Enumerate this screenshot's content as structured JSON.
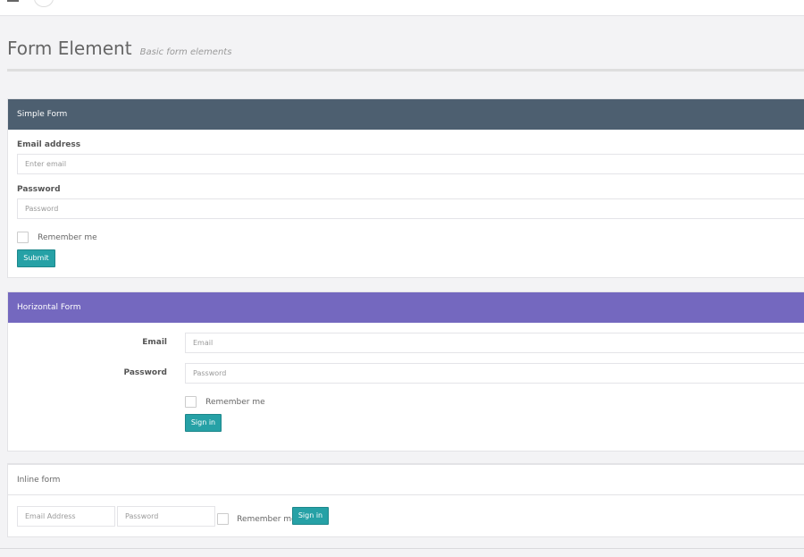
{
  "header": {
    "title": "Form Element",
    "subtitle": "Basic form elements"
  },
  "simple_form": {
    "heading": "Simple Form",
    "email_label": "Email address",
    "email_placeholder": "Enter email",
    "password_label": "Password",
    "password_placeholder": "Password",
    "remember_label": "Remember me",
    "submit_label": "Submit"
  },
  "horizontal_form": {
    "heading": "Horizontal Form",
    "email_label": "Email",
    "email_placeholder": "Email",
    "password_label": "Password",
    "password_placeholder": "Password",
    "remember_label": "Remember me",
    "signin_label": "Sign in"
  },
  "inline_form": {
    "heading": "Inline form",
    "email_placeholder": "Email Address",
    "password_placeholder": "Password",
    "remember_label": "Remember me",
    "signin_label": "Sign in"
  },
  "colors": {
    "simple_header": "#4d5f70",
    "horizontal_header": "#7468bf",
    "button": "#26a1a6"
  },
  "icons": {
    "menu": "hamburger-menu-icon"
  }
}
